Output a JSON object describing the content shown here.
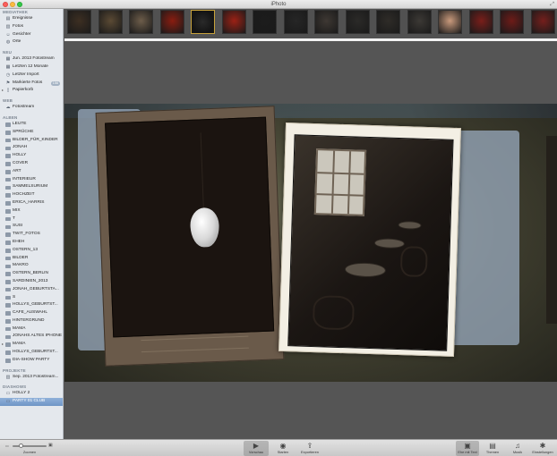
{
  "window": {
    "title": "iPhoto",
    "fullscreen_glyph": "⤢"
  },
  "colors": {
    "sidebar_bg": "#e4e8ed",
    "selection": "#7b9fcf",
    "canvas": "#555555",
    "toolbar": "#d4d4d4",
    "thumb_selected_border": "#c7a23b"
  },
  "sidebar": {
    "sections": [
      {
        "header": "MEDIATHEK",
        "items": [
          {
            "label": "Ereignisse",
            "icon": "events-icon",
            "glyph": "▤"
          },
          {
            "label": "Fotos",
            "icon": "photos-icon",
            "glyph": "▥"
          },
          {
            "label": "Gesichter",
            "icon": "faces-icon",
            "glyph": "☺"
          },
          {
            "label": "Orte",
            "icon": "places-icon",
            "glyph": "◍"
          }
        ]
      },
      {
        "header": "NEU",
        "items": [
          {
            "label": "Jun. 2013 Fotostream",
            "icon": "calendar-icon",
            "glyph": "▦"
          },
          {
            "label": "Letzten 12 Monate",
            "icon": "calendar-icon",
            "glyph": "▦"
          },
          {
            "label": "Letzter Import",
            "icon": "import-icon",
            "glyph": "◷"
          },
          {
            "label": "Markierte Fotos",
            "icon": "flag-icon",
            "glyph": "⚑",
            "badge": "156"
          },
          {
            "label": "Papierkorb",
            "icon": "trash-icon",
            "glyph": "▯",
            "disclosure": "▸"
          }
        ]
      },
      {
        "header": "WEB",
        "items": [
          {
            "label": "Fotostream",
            "icon": "photostream-icon",
            "glyph": "☁"
          }
        ]
      },
      {
        "header": "ALBEN",
        "items": [
          {
            "label": "LEUTE"
          },
          {
            "label": "SPRÜCHE"
          },
          {
            "label": "BILDER_FÜR_KINDER"
          },
          {
            "label": "JONAH"
          },
          {
            "label": "HOLLY"
          },
          {
            "label": "COVER"
          },
          {
            "label": "ART"
          },
          {
            "label": "INTERIEUR"
          },
          {
            "label": "SAMMELSURIUM"
          },
          {
            "label": "HOCHZEIT"
          },
          {
            "label": "ERICA_HARRIS"
          },
          {
            "label": "MIX"
          },
          {
            "label": "T"
          },
          {
            "label": "SUSI"
          },
          {
            "label": "TWIT_FOTOS"
          },
          {
            "label": "EHEH"
          },
          {
            "label": "OSTERN_13"
          },
          {
            "label": "BILDER"
          },
          {
            "label": "MAKRO"
          },
          {
            "label": "OSTERN_BERLIN"
          },
          {
            "label": "SARDINIEN_2013"
          },
          {
            "label": "JONAH_GEBURTSTA..."
          },
          {
            "label": "S"
          },
          {
            "label": "HOLLYS_GEBURTST..."
          },
          {
            "label": "CAFE_AUSWAHL"
          },
          {
            "label": "HINTERGRUND"
          },
          {
            "label": "MAMA"
          },
          {
            "label": "JONAHS ALTES IPHONE"
          },
          {
            "label": "MAMA",
            "disclosure": "▸"
          },
          {
            "label": "HOLLYS_GEBURTST..."
          },
          {
            "label": "DIA-SHOW PARTY"
          }
        ]
      },
      {
        "header": "PROJEKTE",
        "items": [
          {
            "label": "Sep. 2013 Fotostream...",
            "icon": "book-icon",
            "glyph": "▥"
          }
        ]
      },
      {
        "header": "DIASHOWS",
        "items": [
          {
            "label": "HOLLY 2",
            "icon": "slideshow-icon",
            "glyph": "▭"
          },
          {
            "label": "PARTY 01 CLUB",
            "icon": "slideshow-icon",
            "glyph": "▭",
            "selected": true
          }
        ]
      }
    ]
  },
  "filmstrip": {
    "thumbnails": [
      {
        "name": "thumb-1",
        "tone": "#3d2f22",
        "selected": false
      },
      {
        "name": "thumb-2",
        "tone": "#5b4a34",
        "selected": false
      },
      {
        "name": "thumb-3",
        "tone": "#6d5d4a",
        "selected": false
      },
      {
        "name": "thumb-4",
        "tone": "#8a1d10",
        "selected": false
      },
      {
        "name": "thumb-5",
        "tone": "#141414",
        "selected": true
      },
      {
        "name": "thumb-6",
        "tone": "#9c2115",
        "selected": false
      },
      {
        "name": "thumb-7",
        "tone": "#1c1c1c",
        "selected": false
      },
      {
        "name": "thumb-8",
        "tone": "#262626",
        "selected": false
      },
      {
        "name": "thumb-9",
        "tone": "#3e3833",
        "selected": false
      },
      {
        "name": "thumb-10",
        "tone": "#2b2a28",
        "selected": false
      },
      {
        "name": "thumb-11",
        "tone": "#2f2c28",
        "selected": false
      },
      {
        "name": "thumb-12",
        "tone": "#3c3935",
        "selected": false
      },
      {
        "name": "thumb-13",
        "tone": "#c99a7c",
        "selected": false
      },
      {
        "name": "thumb-14",
        "tone": "#7a1e1a",
        "selected": false
      },
      {
        "name": "thumb-15",
        "tone": "#6e1b18",
        "selected": false
      },
      {
        "name": "thumb-16",
        "tone": "#751f1c",
        "selected": false
      }
    ]
  },
  "toolbar": {
    "zoom_label": "Zoomen",
    "zoom_level": 0.2,
    "items": [
      {
        "label": "Vorschau",
        "icon": "preview-icon",
        "glyph": "▶",
        "active": true
      },
      {
        "label": "Starten",
        "icon": "play-icon",
        "glyph": "◉"
      },
      {
        "label": "Exportieren",
        "icon": "export-icon",
        "glyph": "⇪"
      }
    ],
    "right_items": [
      {
        "label": "Ehe mit Text",
        "icon": "theme-icon",
        "glyph": "▣",
        "active": true
      },
      {
        "label": "Themen",
        "icon": "themes-icon",
        "glyph": "▤"
      },
      {
        "label": "Musik",
        "icon": "music-icon",
        "glyph": "♫"
      },
      {
        "label": "Einstellungen",
        "icon": "settings-gear-icon",
        "glyph": "✱"
      }
    ]
  }
}
